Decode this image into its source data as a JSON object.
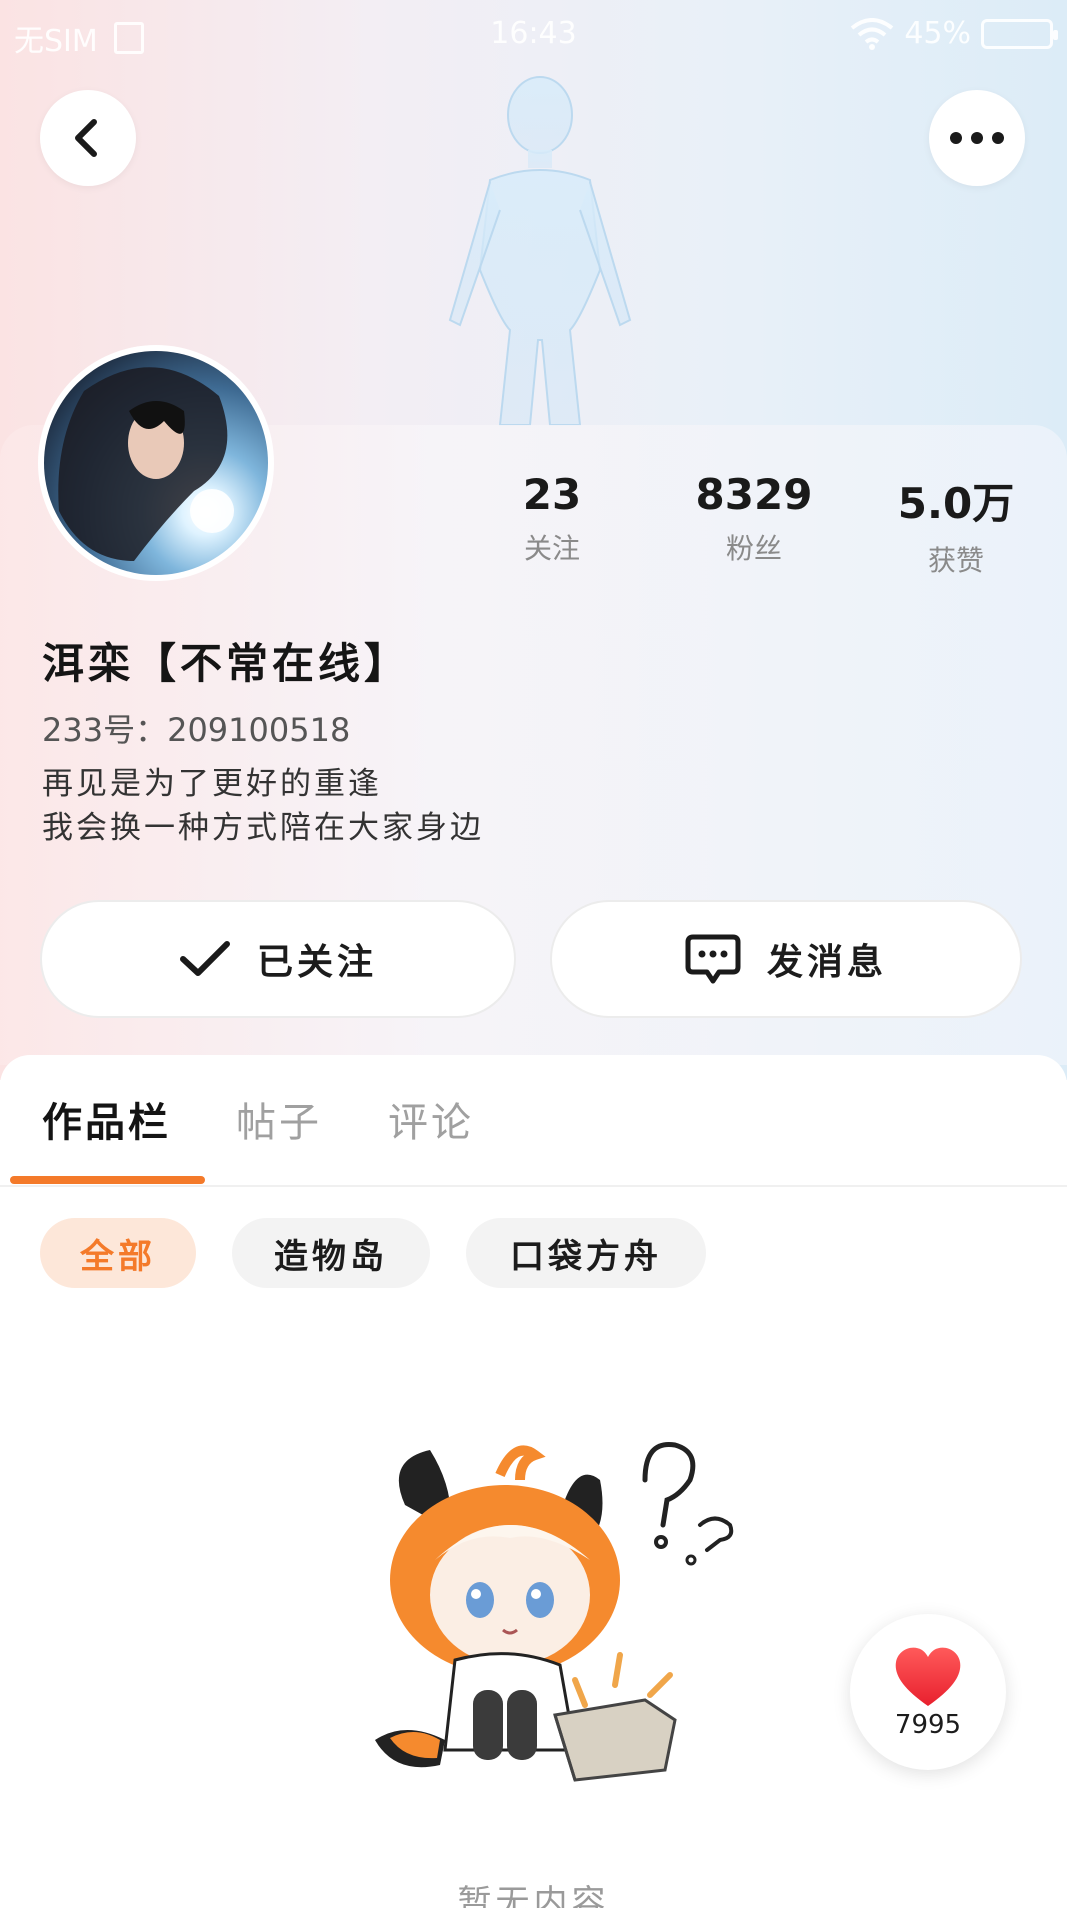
{
  "status_bar": {
    "carrier": "无SIM",
    "time": "16:43",
    "battery": "45%"
  },
  "header": {
    "back_icon": "chevron-left-icon",
    "more_icon": "ellipsis-icon"
  },
  "profile": {
    "name": "洱栾【不常在线】",
    "id_label": "233号：209100518",
    "bio_lines": [
      "再见是为了更好的重逢",
      "我会换一种方式陪在大家身边"
    ],
    "stats": [
      {
        "value": "23",
        "label": "关注"
      },
      {
        "value": "8329",
        "label": "粉丝"
      },
      {
        "value": "5.0万",
        "label": "获赞"
      }
    ]
  },
  "actions": {
    "follow_label": "已关注",
    "message_label": "发消息"
  },
  "tabs": [
    "作品栏",
    "帖子",
    "评论"
  ],
  "filters": [
    "全部",
    "造物岛",
    "口袋方舟"
  ],
  "empty_state": {
    "text": "暂无内容"
  },
  "like_button": {
    "count": "7995"
  },
  "colors": {
    "accent": "#f47a2a",
    "accent_bg": "#fde7d9",
    "heart": "#f0323c"
  }
}
